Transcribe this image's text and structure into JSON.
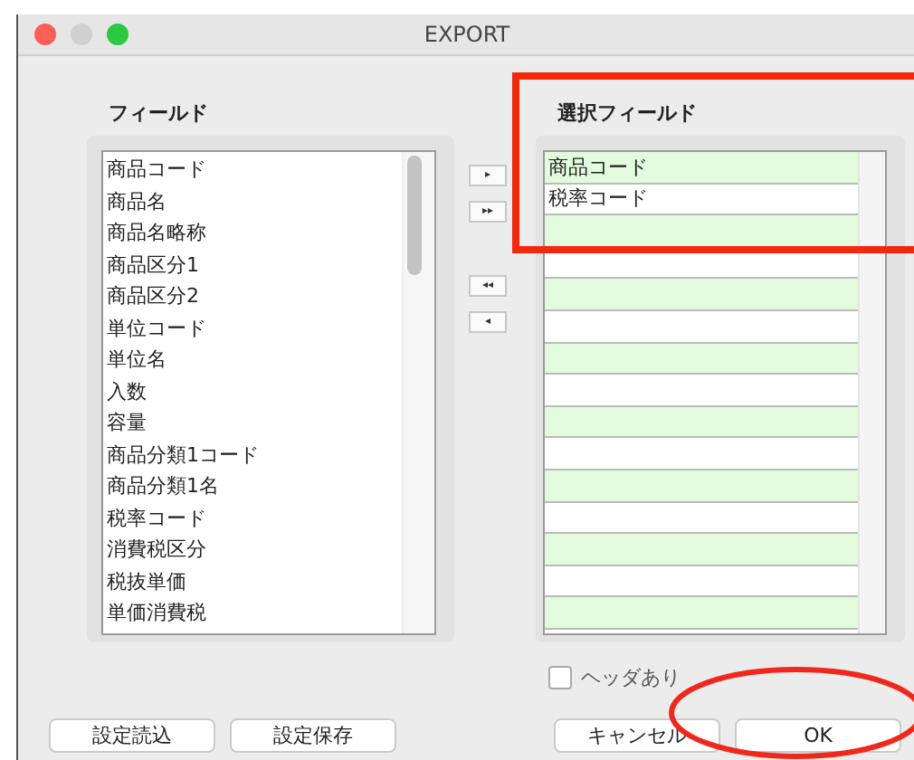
{
  "window": {
    "title": "EXPORT"
  },
  "fields": {
    "label": "フィールド",
    "items": [
      "商品コード",
      "商品名",
      "商品名略称",
      "商品区分1",
      "商品区分2",
      "単位コード",
      "単位名",
      "入数",
      "容量",
      "商品分類1コード",
      "商品分類1名",
      "税率コード",
      "消費税区分",
      "税抜単価",
      "単価消費税"
    ]
  },
  "move_buttons": [
    {
      "kind": "add",
      "glyph": "▸"
    },
    {
      "kind": "add_all",
      "glyph": "▸▸"
    },
    {
      "kind": "remove_all",
      "glyph": "◂◂"
    },
    {
      "kind": "remove",
      "glyph": "◂"
    }
  ],
  "selected_fields": {
    "label": "選択フィールド",
    "items": [
      "商品コード",
      "税率コード"
    ]
  },
  "header_option": {
    "label": "ヘッダあり",
    "checked": false
  },
  "buttons": {
    "left": [
      "設定読込",
      "設定保存"
    ],
    "right": [
      "キャンセル",
      "OK"
    ]
  }
}
